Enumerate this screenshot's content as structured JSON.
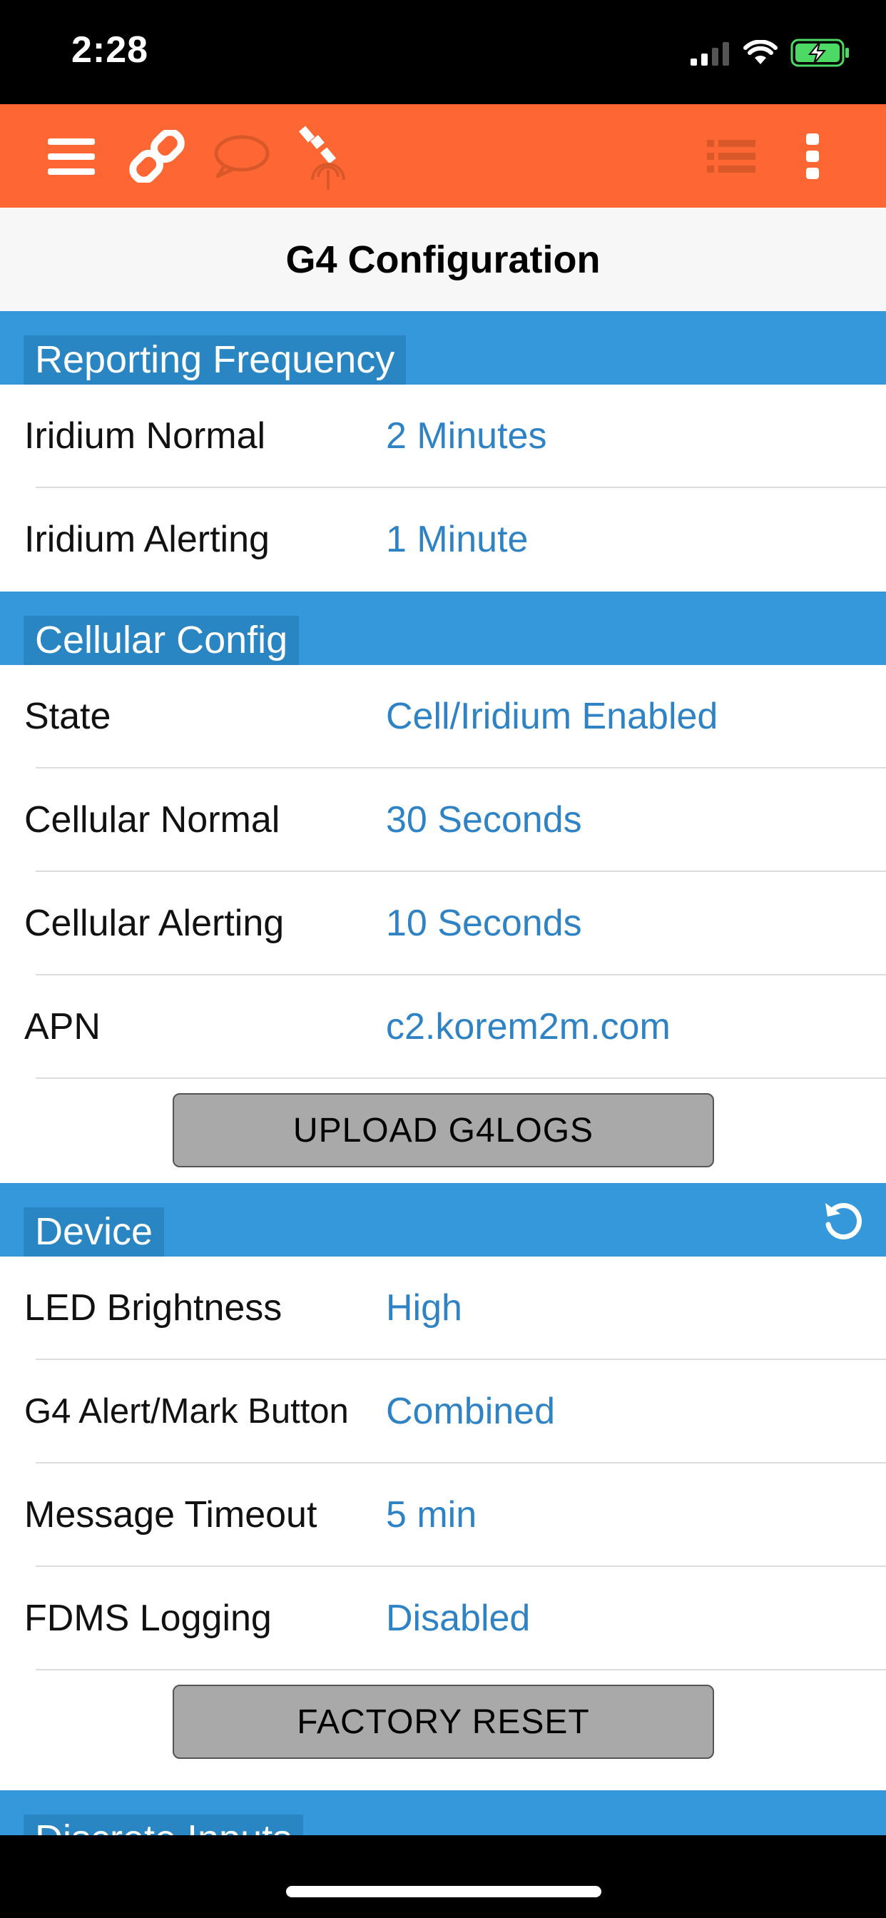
{
  "status_bar": {
    "time": "2:28"
  },
  "app_bar": {
    "icons": [
      "menu-icon",
      "link-icon",
      "message-icon",
      "satellite-icon",
      "list-icon",
      "more-icon"
    ],
    "accent": "#fe6734"
  },
  "page": {
    "title": "G4 Configuration"
  },
  "sections": {
    "reporting": {
      "title": "Reporting Frequency",
      "rows": [
        {
          "label": "Iridium Normal",
          "value": "2 Minutes"
        },
        {
          "label": "Iridium Alerting",
          "value": "1 Minute"
        }
      ]
    },
    "cellular": {
      "title": "Cellular Config",
      "rows": [
        {
          "label": "State",
          "value": "Cell/Iridium Enabled"
        },
        {
          "label": "Cellular Normal",
          "value": "30 Seconds"
        },
        {
          "label": "Cellular Alerting",
          "value": "10 Seconds"
        },
        {
          "label": "APN",
          "value": "c2.korem2m.com"
        }
      ],
      "button": "UPLOAD G4LOGS"
    },
    "device": {
      "title": "Device",
      "rows": [
        {
          "label": "LED Brightness",
          "value": "High"
        },
        {
          "label": "G4 Alert/Mark Button",
          "value": "Combined"
        },
        {
          "label": "Message Timeout",
          "value": "5 min"
        },
        {
          "label": "FDMS Logging",
          "value": "Disabled"
        }
      ],
      "button": "FACTORY RESET"
    },
    "discrete": {
      "title": "Discrete Inputs"
    }
  },
  "colors": {
    "section_bg": "#3498db",
    "value_text": "#2f83c4",
    "button_bg": "#a9a9a9"
  }
}
